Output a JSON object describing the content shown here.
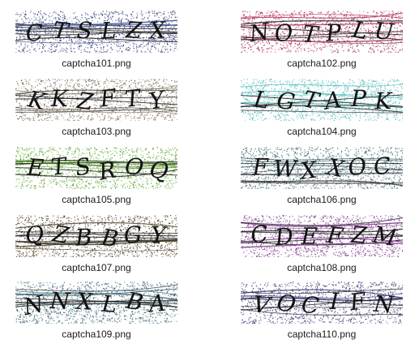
{
  "files": [
    {
      "name": "captcha101.png",
      "text": "CTSLZX",
      "color": "#2f3d7a"
    },
    {
      "name": "captcha102.png",
      "text": "NOTPLU",
      "color": "#a8284e"
    },
    {
      "name": "captcha103.png",
      "text": "KKZFTY",
      "color": "#7a6a55"
    },
    {
      "name": "captcha104.png",
      "text": "LGTAPK",
      "color": "#4fb8b8"
    },
    {
      "name": "captcha105.png",
      "text": "ETSROQ",
      "color": "#5aa028"
    },
    {
      "name": "captcha106.png",
      "text": "FWXXOC",
      "color": "#3a6470"
    },
    {
      "name": "captcha107.png",
      "text": "QZBBGY",
      "color": "#4a3a20"
    },
    {
      "name": "captcha108.png",
      "text": "CDEFZM",
      "color": "#7a2f88"
    },
    {
      "name": "captcha109.png",
      "text": "NNXLBA",
      "color": "#2f5a6a"
    },
    {
      "name": "captcha110.png",
      "text": "VOCIFN",
      "color": "#3a3a78"
    }
  ]
}
